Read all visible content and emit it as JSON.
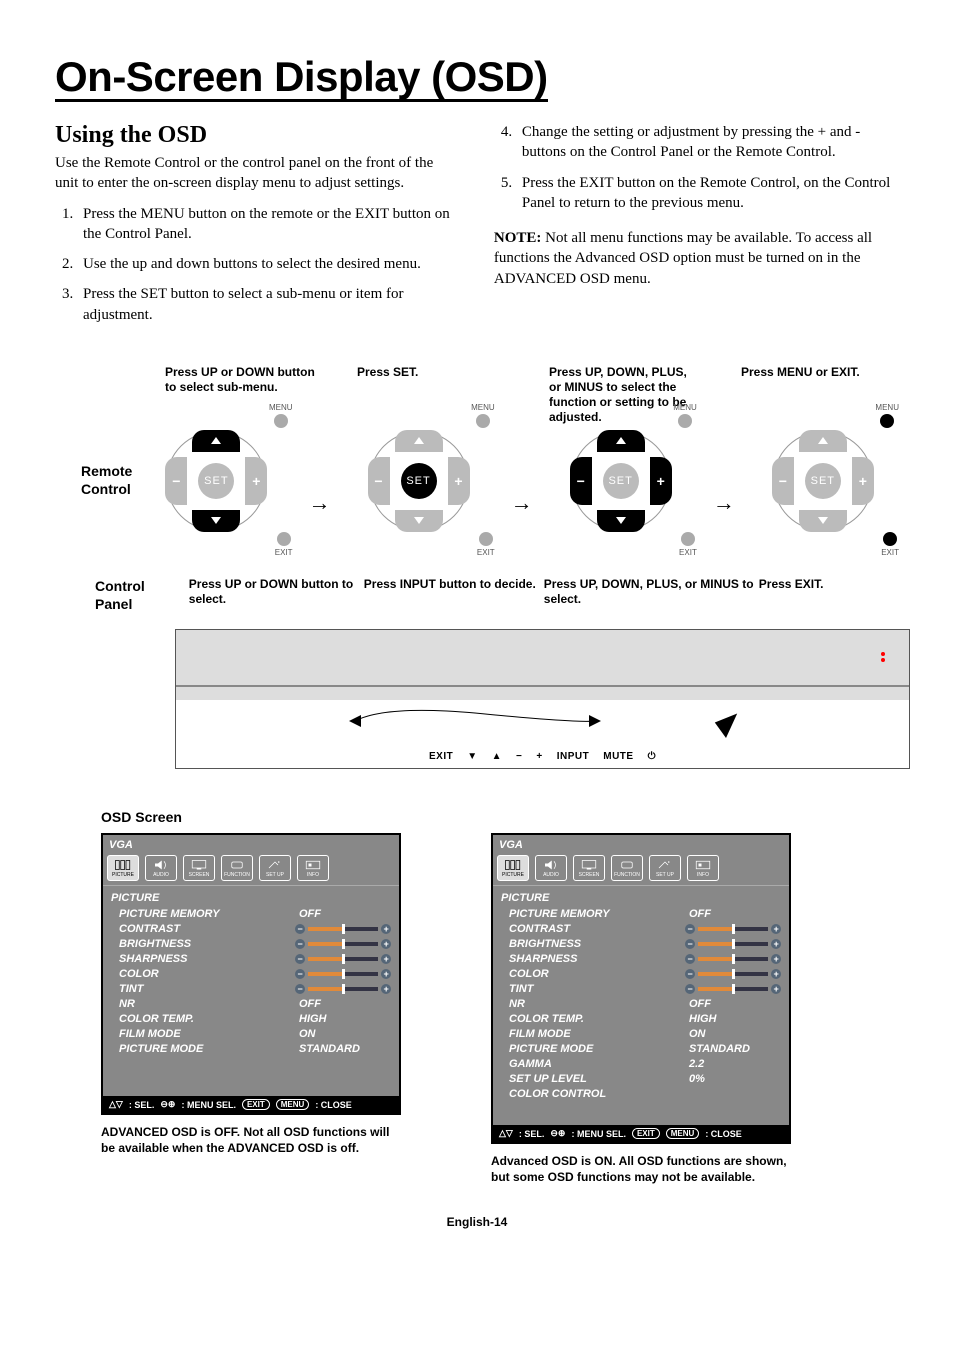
{
  "title": "On-Screen Display (OSD)",
  "section_heading": "Using the OSD",
  "intro": "Use the Remote Control or the control panel on the front of the unit to enter the on-screen display menu to adjust settings.",
  "steps_left": [
    "Press the MENU button on the remote or the EXIT button on the Control Panel.",
    "Use the up and down buttons to select the desired menu.",
    "Press the SET button to select a sub-menu or item for adjustment."
  ],
  "steps_right": [
    "Change the setting or adjustment by pressing  the + and - buttons on the Control Panel or the Remote Control.",
    "Press the EXIT button on the Remote Control, on the Control Panel to return to the previous menu."
  ],
  "note_label": "NOTE:",
  "note_text": " Not all menu functions may be available. To access all functions the Advanced OSD option must be turned on in the ADVANCED OSD menu.",
  "remote": {
    "label": "Remote Control",
    "captions": [
      "Press UP or DOWN button to select sub-menu.",
      "Press SET.",
      "Press UP, DOWN, PLUS, or MINUS to select  the function or setting to be adjusted.",
      "Press MENU or EXIT."
    ],
    "menu": "MENU",
    "exit": "EXIT",
    "set": "SET"
  },
  "control": {
    "label": "Control Panel",
    "captions": [
      "Press UP or DOWN button to select.",
      "Press INPUT button to decide.",
      "Press UP, DOWN, PLUS, or MINUS to select.",
      "Press EXIT."
    ],
    "buttons": {
      "exit": "EXIT",
      "down": "▼",
      "up": "▲",
      "minus": "−",
      "plus": "+",
      "input": "INPUT",
      "mute": "MUTE"
    }
  },
  "osd_title": "OSD Screen",
  "osd": {
    "source": "VGA",
    "heading": "PICTURE",
    "tabs": [
      "PICTURE",
      "AUDIO",
      "SCREEN",
      "FUNCTION",
      "SET UP",
      "INFO"
    ],
    "items_basic": [
      {
        "k": "PICTURE MEMORY",
        "v": "OFF"
      },
      {
        "k": "CONTRAST",
        "v": "slider"
      },
      {
        "k": "BRIGHTNESS",
        "v": "slider"
      },
      {
        "k": "SHARPNESS",
        "v": "slider"
      },
      {
        "k": "COLOR",
        "v": "slider"
      },
      {
        "k": "TINT",
        "v": "slider"
      },
      {
        "k": "NR",
        "v": "OFF"
      },
      {
        "k": "COLOR TEMP.",
        "v": "HIGH"
      },
      {
        "k": "FILM MODE",
        "v": "ON"
      },
      {
        "k": "PICTURE MODE",
        "v": "STANDARD"
      }
    ],
    "items_adv_extra": [
      {
        "k": "GAMMA",
        "v": "2.2"
      },
      {
        "k": "SET UP LEVEL",
        "v": "0%"
      },
      {
        "k": "COLOR CONTROL",
        "v": ""
      }
    ],
    "footer": {
      "sel": ": SEL.",
      "menu": ": MENU SEL.",
      "exit_pill": "EXIT",
      "menu_pill": "MENU",
      "close": ": CLOSE"
    },
    "caption_off": "ADVANCED OSD is OFF. Not all OSD functions will be available when the ADVANCED OSD is off.",
    "caption_on": "Advanced OSD is ON. All OSD functions are shown, but some OSD functions may not be available."
  },
  "page_number": "English-14"
}
